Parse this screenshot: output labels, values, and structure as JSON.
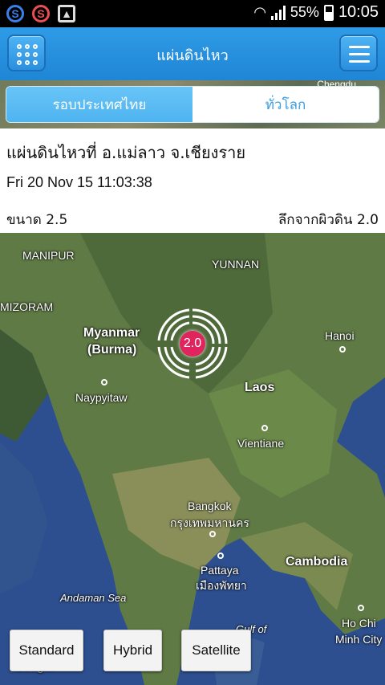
{
  "status_bar": {
    "battery": "55%",
    "time": "10:05"
  },
  "header": {
    "title": "แผ่นดินไหว"
  },
  "tabs": [
    {
      "label": "รอบประเทศไทย",
      "active": true
    },
    {
      "label": "ทั่วโลก",
      "active": false
    }
  ],
  "strip_label": "Chengdu",
  "quake": {
    "title": "แผ่นดินไหวที่ อ.แม่ลาว จ.เชียงราย",
    "datetime": "Fri 20 Nov 15 11:03:38",
    "magnitude": "ขนาด 2.5",
    "depth": "ลึกจากผิวดิน 2.0",
    "marker_value": "2.0"
  },
  "map": {
    "labels": {
      "manipur": "MANIPUR",
      "yunnan": "YUNNAN",
      "mizoram": "MIZORAM",
      "myanmar": "Myanmar",
      "burma": "(Burma)",
      "naypyitaw": "Naypyitaw",
      "hanoi": "Hanoi",
      "laos": "Laos",
      "vientiane": "Vientiane",
      "bangkok": "Bangkok",
      "bangkok_th": "กรุงเทพมหานคร",
      "pattaya": "Pattaya",
      "pattaya_th": "เมืองพัทยา",
      "cambodia": "Cambodia",
      "andaman": "Andaman Sea",
      "gulf": "Gulf of",
      "hochi": "Ho Chi",
      "minh": "Minh City",
      "google": "Google"
    },
    "buttons": {
      "standard": "Standard",
      "hybrid": "Hybrid",
      "satellite": "Satellite"
    }
  },
  "colors": {
    "header": "#1f86d6",
    "tab_active": "#4fb4f0",
    "marker": "#e0245e"
  }
}
